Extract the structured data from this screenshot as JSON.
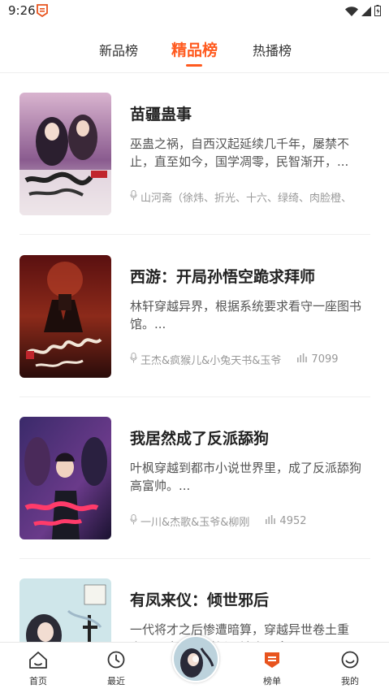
{
  "status_bar": {
    "time": "9:26"
  },
  "tabs": [
    {
      "label": "新品榜"
    },
    {
      "label": "精品榜"
    },
    {
      "label": "热播榜"
    }
  ],
  "books": [
    {
      "title": "苗疆蛊事",
      "description": "巫蛊之祸，自西汉起延续几千年，屡禁不止，直至如今，国学凋零，民智渐开，...",
      "authors": "山河斋（徐炜、折光、十六、绿绮、肉脸橙、",
      "plays": ""
    },
    {
      "title": "西游：开局孙悟空跪求拜师",
      "description": "林轩穿越异界，根据系统要求看守一座图书馆。...",
      "authors": "王杰&疯猴儿&小兔天书&玉爷",
      "plays": "7099"
    },
    {
      "title": "我居然成了反派舔狗",
      "description": "叶枫穿越到都市小说世界里，成了反派舔狗高富帅。...",
      "authors": "一川&杰歌&玉爷&柳刚",
      "plays": "4952"
    },
    {
      "title": "有凤来仪：倾世邪后",
      "description": "一代将才之后惨遭暗算，穿越异世卷土重来，一定谁这样倒是社会下拿下...",
      "authors": "",
      "plays": ""
    }
  ],
  "bottom_nav": [
    {
      "label": "首页",
      "icon": "home-icon"
    },
    {
      "label": "最近",
      "icon": "clock-icon"
    },
    {
      "label": "榜单",
      "icon": "rank-icon"
    },
    {
      "label": "我的",
      "icon": "profile-icon"
    }
  ],
  "colors": {
    "accent": "#ff5a1f",
    "text": "#222222",
    "muted": "#999999"
  }
}
